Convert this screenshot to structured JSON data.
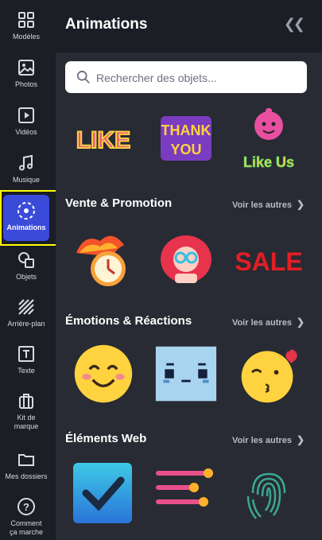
{
  "sidebar": {
    "items": [
      {
        "label": "Modèles",
        "icon": "templates-icon"
      },
      {
        "label": "Photos",
        "icon": "photo-icon"
      },
      {
        "label": "Vidéos",
        "icon": "video-icon"
      },
      {
        "label": "Musique",
        "icon": "music-icon"
      },
      {
        "label": "Animations",
        "icon": "animation-icon",
        "active": true
      },
      {
        "label": "Objets",
        "icon": "shapes-icon"
      },
      {
        "label": "Arrière-plan",
        "icon": "background-icon"
      },
      {
        "label": "Texte",
        "icon": "text-icon"
      },
      {
        "label": "Kit de marque",
        "icon": "briefcase-icon"
      },
      {
        "label": "Mes dossiers",
        "icon": "folder-icon"
      },
      {
        "label": "Comment ça marche",
        "icon": "help-icon"
      }
    ]
  },
  "panel": {
    "title": "Animations",
    "search_placeholder": "Rechercher des objets...",
    "sections": [
      {
        "title": "Vente & Promotion",
        "see_more": "Voir les autres"
      },
      {
        "title": "Émotions & Réactions",
        "see_more": "Voir les autres"
      },
      {
        "title": "Éléments Web",
        "see_more": "Voir les autres"
      }
    ],
    "stickers": {
      "like": "LIKE",
      "thank_you_1": "THANK",
      "thank_you_2": "YOU",
      "like_us": "Like Us",
      "sale": "SALE"
    }
  },
  "colors": {
    "accent": "#3b4bd9",
    "highlight": "#ffff00"
  }
}
